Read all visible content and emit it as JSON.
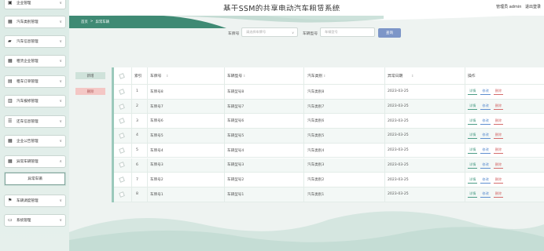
{
  "header": {
    "title": "基于SSM的共享电动汽车租赁系统",
    "user": "管理员 admin",
    "logout": "退出登录"
  },
  "breadcrumb": {
    "home": "首页",
    "sep": ">",
    "current": "异常车辆"
  },
  "sidebar": {
    "items": [
      {
        "label": "企业管理",
        "icon": "briefcase-icon"
      },
      {
        "label": "汽车类别管理",
        "icon": "grid-icon"
      },
      {
        "label": "汽车信息管理",
        "icon": "car-icon"
      },
      {
        "label": "租赁企业管理",
        "icon": "grid-icon"
      },
      {
        "label": "租车订单管理",
        "icon": "clipboard-icon"
      },
      {
        "label": "汽车报修管理",
        "icon": "wrench-icon"
      },
      {
        "label": "还车信息管理",
        "icon": "list-icon"
      },
      {
        "label": "企业公告管理",
        "icon": "grid-icon"
      },
      {
        "label": "异常车辆管理",
        "icon": "grid-icon"
      },
      {
        "label": "车辆调度管理",
        "icon": "flag-icon"
      },
      {
        "label": "系统管理",
        "icon": "monitor-icon"
      }
    ],
    "sub_item": "异常车辆"
  },
  "search": {
    "plate_label": "车牌号",
    "plate_placeholder": "请选择车牌号",
    "model_label": "车辆型号",
    "model_placeholder": "车辆型号",
    "button": "查询"
  },
  "actions": {
    "add": "新增",
    "delete": "删除"
  },
  "table": {
    "headers": [
      "索引",
      "车牌号",
      "车辆型号",
      "汽车类别",
      "异常日期",
      "操作"
    ],
    "ops": [
      "详情",
      "修改",
      "删除"
    ],
    "rows": [
      [
        "1",
        "车牌号8",
        "车辆型号8",
        "汽车类别8",
        "2023-03-25"
      ],
      [
        "2",
        "车牌号7",
        "车辆型号7",
        "汽车类别7",
        "2023-03-25"
      ],
      [
        "3",
        "车牌号6",
        "车辆型号6",
        "汽车类别6",
        "2023-03-25"
      ],
      [
        "4",
        "车牌号5",
        "车辆型号5",
        "汽车类别5",
        "2023-03-25"
      ],
      [
        "5",
        "车牌号4",
        "车辆型号4",
        "汽车类别4",
        "2023-03-25"
      ],
      [
        "6",
        "车牌号3",
        "车辆型号3",
        "汽车类别3",
        "2023-03-25"
      ],
      [
        "7",
        "车牌号2",
        "车辆型号2",
        "汽车类别2",
        "2023-03-25"
      ],
      [
        "8",
        "车牌号1",
        "车辆型号1",
        "汽车类别1",
        "2023-03-25"
      ]
    ]
  },
  "colors": {
    "accent": "#3f8a74",
    "search_button": "#7d96c8",
    "delete": "#d46b6b"
  }
}
